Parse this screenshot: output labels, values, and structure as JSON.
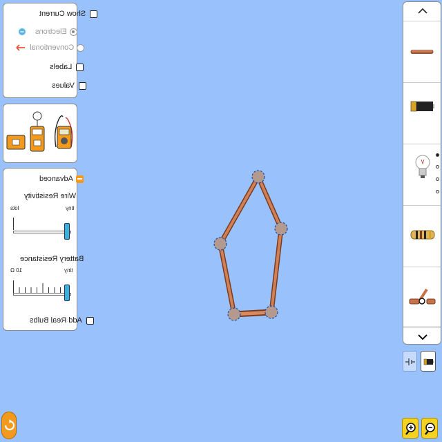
{
  "controls": {
    "show_current": "Show Current",
    "electrons": "Electrons",
    "conventional": "Conventional",
    "labels": "Labels",
    "values": "Values"
  },
  "advanced": {
    "title": "Advanced",
    "wire_resistivity": {
      "label": "Wire Resistivity",
      "min_label": "tiny",
      "max_label": "lots",
      "level": 0
    },
    "battery_resistance": {
      "label": "Battery Resistance",
      "min_label": "tiny",
      "max_label": "10 Ω",
      "level": 0
    },
    "add_real_bulbs": "Add Real Bulbs"
  },
  "toolbox": {
    "scroll_up": "^",
    "scroll_down": "v",
    "items": [
      "wire",
      "battery",
      "light-bulb",
      "resistor",
      "switch"
    ],
    "page_count": 4,
    "active_page": 0
  },
  "view_toggle": [
    "schematic-view",
    "lifelike-view"
  ],
  "colors": {
    "background": "#99c2fd",
    "copper": "#c8734a",
    "slider_thumb": "#3ab0d8",
    "reset_orange": "#f29a1e",
    "zoom_yellow": "#f5d21f"
  },
  "circuit": {
    "wires": 5,
    "vertices": 5
  }
}
